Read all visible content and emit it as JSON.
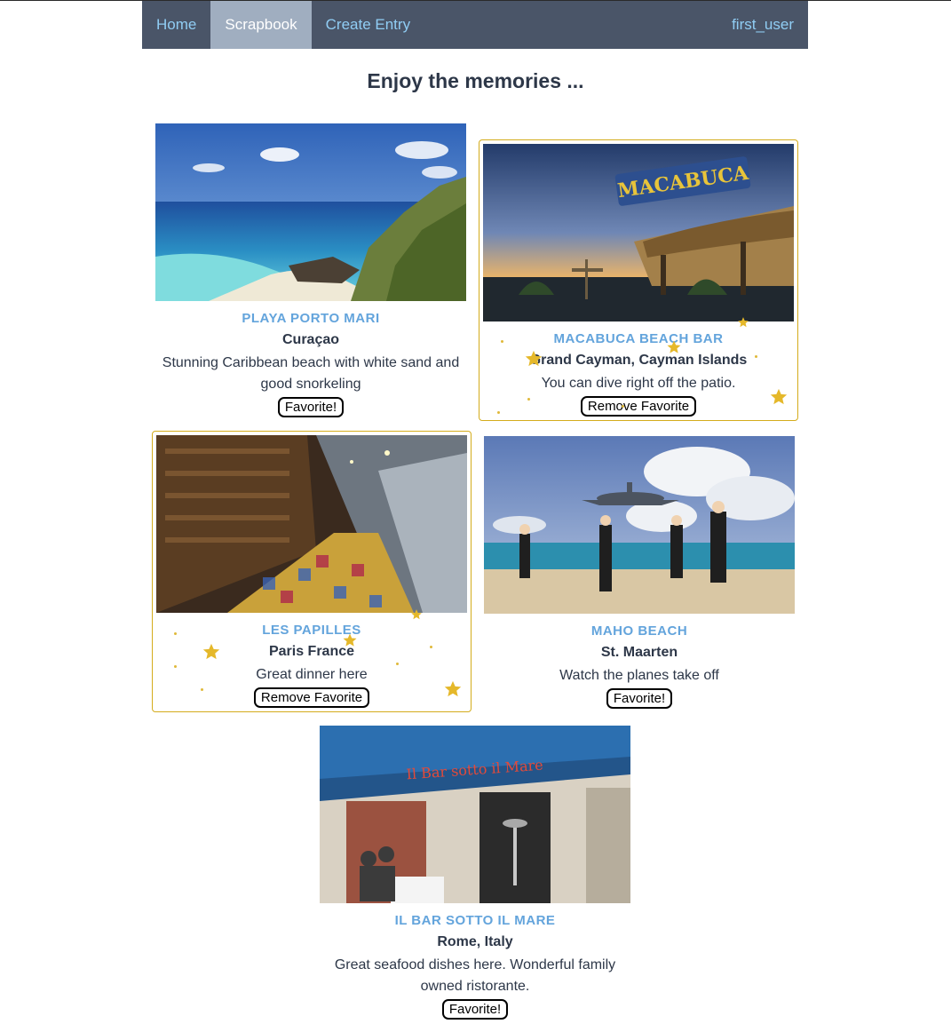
{
  "nav": {
    "items": [
      {
        "label": "Home",
        "active": false
      },
      {
        "label": "Scrapbook",
        "active": true
      },
      {
        "label": "Create Entry",
        "active": false
      }
    ],
    "user": "first_user",
    "colors": {
      "bar": "#4a5568",
      "active_bg": "#a0aec0",
      "link": "#90cdf4"
    }
  },
  "page": {
    "title": "Enjoy the memories ..."
  },
  "entries": [
    {
      "title": "PLAYA PORTO MARI",
      "location": "Curaçao",
      "description": "Stunning Caribbean beach with white sand and good snorkeling",
      "button": "Favorite!",
      "favorite": false
    },
    {
      "title": "MACABUCA BEACH BAR",
      "location": "Grand Cayman, Cayman Islands",
      "description": "You can dive right off the patio.",
      "button": "Remove Favorite",
      "favorite": true
    },
    {
      "title": "LES PAPILLES",
      "location": "Paris France",
      "description": "Great dinner here",
      "button": "Remove Favorite",
      "favorite": true
    },
    {
      "title": "MAHO BEACH",
      "location": "St. Maarten",
      "description": "Watch the planes take off",
      "button": "Favorite!",
      "favorite": false
    },
    {
      "title": "IL BAR SOTTO IL MARE",
      "location": "Rome, Italy",
      "description": "Great seafood dishes here. Wonderful family owned ristorante.",
      "button": "Favorite!",
      "favorite": false
    }
  ],
  "accent": {
    "favorite_border": "#d4ac1c",
    "star": "#e5b82a",
    "title": "#63a4dc"
  }
}
